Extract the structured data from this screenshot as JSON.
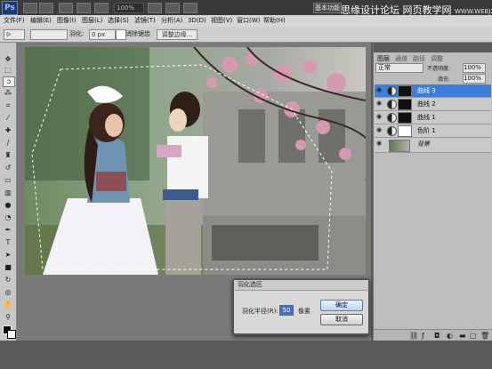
{
  "app": {
    "logo": "Ps"
  },
  "titlebar": {
    "zoom": "100%",
    "workspace": "基本功能",
    "watermark": "思缘设计论坛",
    "watermark2": "网页教学网",
    "watermark_url": "WWW.WEBJX.COM"
  },
  "menu": [
    "文件(F)",
    "编辑(E)",
    "图像(I)",
    "图层(L)",
    "选择(S)",
    "滤镜(T)",
    "分析(A)",
    "3D(D)",
    "视图(V)",
    "窗口(W)",
    "帮助(H)"
  ],
  "options": {
    "feather_label": "羽化:",
    "feather_value": "0 px",
    "antialias_label": "消除锯齿",
    "refine_label": "调整边缘..."
  },
  "layers_panel": {
    "tabs": [
      "图层",
      "通道",
      "路径",
      "调整"
    ],
    "blend_mode": "正常",
    "opacity_label": "不透明度:",
    "opacity": "100%",
    "fill_label": "填充:",
    "fill": "100%",
    "layers": [
      {
        "name": "曲线 3",
        "selected": true,
        "mask": "black"
      },
      {
        "name": "曲线 2",
        "selected": false,
        "mask": "black"
      },
      {
        "name": "曲线 1",
        "selected": false,
        "mask": "black"
      },
      {
        "name": "色阶 1",
        "selected": false,
        "mask": "white"
      },
      {
        "name": "背景",
        "selected": false,
        "mask": "photo"
      }
    ]
  },
  "dialog": {
    "title": "羽化选区",
    "label": "羽化半径(R):",
    "value": "50",
    "unit": "像素",
    "ok": "确定",
    "cancel": "取消"
  },
  "icons": [
    "move-icon",
    "marquee-icon",
    "lasso-icon",
    "quick-select-icon",
    "crop-icon",
    "eyedropper-icon",
    "healing-icon",
    "brush-icon",
    "stamp-icon",
    "history-brush-icon",
    "eraser-icon",
    "gradient-icon",
    "blur-icon",
    "dodge-icon",
    "pen-icon",
    "type-icon",
    "path-select-icon",
    "shape-icon",
    "3d-rotate-icon",
    "3d-orbit-icon",
    "hand-icon",
    "zoom-icon"
  ]
}
